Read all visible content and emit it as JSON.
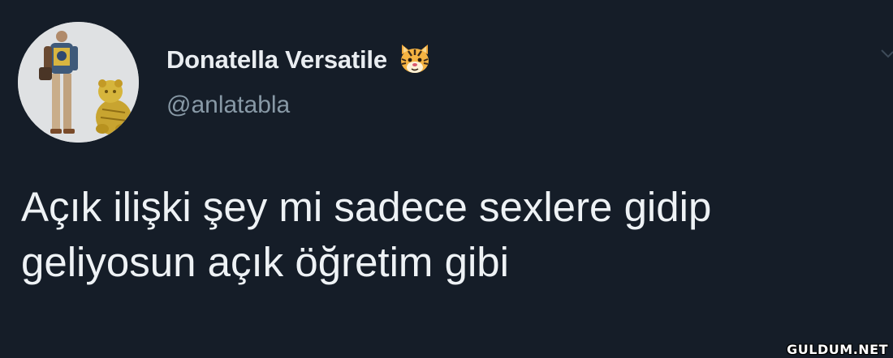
{
  "tweet": {
    "display_name": "Donatella Versatile",
    "name_emoji": "tiger-face-emoji",
    "handle": "@anlatabla",
    "text_lines": [
      "Açık ilişki şey mi sadece sexlere gidip",
      "geliyosun açık öğretim gibi"
    ]
  },
  "icons": {
    "avatar": "person-with-golden-tiger-avatar",
    "menu": "chevron-down-icon"
  },
  "watermark": "GULDUM.NET",
  "colors": {
    "background": "#151d28",
    "name": "#e9edf1",
    "handle": "#8899a6",
    "text": "#eef2f5"
  }
}
